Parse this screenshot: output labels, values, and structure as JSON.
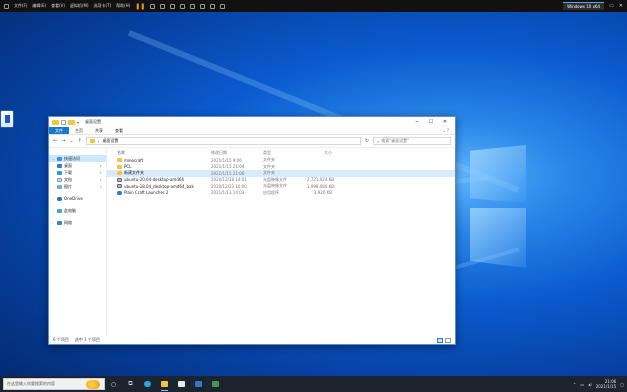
{
  "vmbar": {
    "menus": [
      "文件(F)",
      "编辑(E)",
      "查看(V)",
      "虚拟机(M)",
      "选项卡(T)",
      "帮助(H)"
    ],
    "vm_tab": "Windows 10 x64"
  },
  "window": {
    "title": "桌面设置",
    "ribbon_tabs": [
      "文件",
      "主页",
      "共享",
      "查看"
    ],
    "address_path": "桌面设置",
    "search_placeholder": "搜索\"桌面设置\""
  },
  "nav": {
    "items": [
      {
        "label": "快速访问",
        "icon": "star-icon"
      },
      {
        "label": "桌面",
        "icon": "desktop-folder-icon"
      },
      {
        "label": "下载",
        "icon": "download-folder-icon"
      },
      {
        "label": "文档",
        "icon": "documents-folder-icon"
      },
      {
        "label": "图片",
        "icon": "pictures-folder-icon"
      },
      {
        "label": "OneDrive",
        "icon": "onedrive-icon"
      },
      {
        "label": "此电脑",
        "icon": "this-pc-icon"
      },
      {
        "label": "网络",
        "icon": "network-icon"
      }
    ]
  },
  "files": {
    "columns": {
      "name": "名称",
      "date": "修改日期",
      "type": "类型",
      "size": "大小"
    },
    "rows": [
      {
        "name": "minecraft",
        "date": "2021/1/15 9:06",
        "type": "文件夹",
        "size": "",
        "icon": "folder-icon"
      },
      {
        "name": "PCL",
        "date": "2021/1/15 21:04",
        "type": "文件夹",
        "size": "",
        "icon": "folder-icon"
      },
      {
        "name": "新建文件夹",
        "date": "2021/1/15 21:06",
        "type": "文件夹",
        "size": "",
        "icon": "folder-icon"
      },
      {
        "name": "ubuntu-20.04-desktop-amd64",
        "date": "2020/12/18 14:01",
        "type": "光盘映像文件",
        "size": "2,721,024 KB",
        "icon": "disc-image-icon"
      },
      {
        "name": "ubuntu-18.04_desktop-amd64_bak",
        "date": "2020/12/23 10:00",
        "type": "光盘映像文件",
        "size": "1,998,080 KB",
        "icon": "disc-image-icon"
      },
      {
        "name": "Plain Craft Launcher 2",
        "date": "2021/1/13 14:03",
        "type": "应用程序",
        "size": "3,920 KB",
        "icon": "app-icon"
      }
    ]
  },
  "status": {
    "count": "6 个项目",
    "selected": "选中 1 个项目"
  },
  "taskbar": {
    "search_placeholder": "在这里输入你要搜索的内容"
  },
  "tray": {
    "time": "21:06",
    "date": "2021/1/15"
  }
}
